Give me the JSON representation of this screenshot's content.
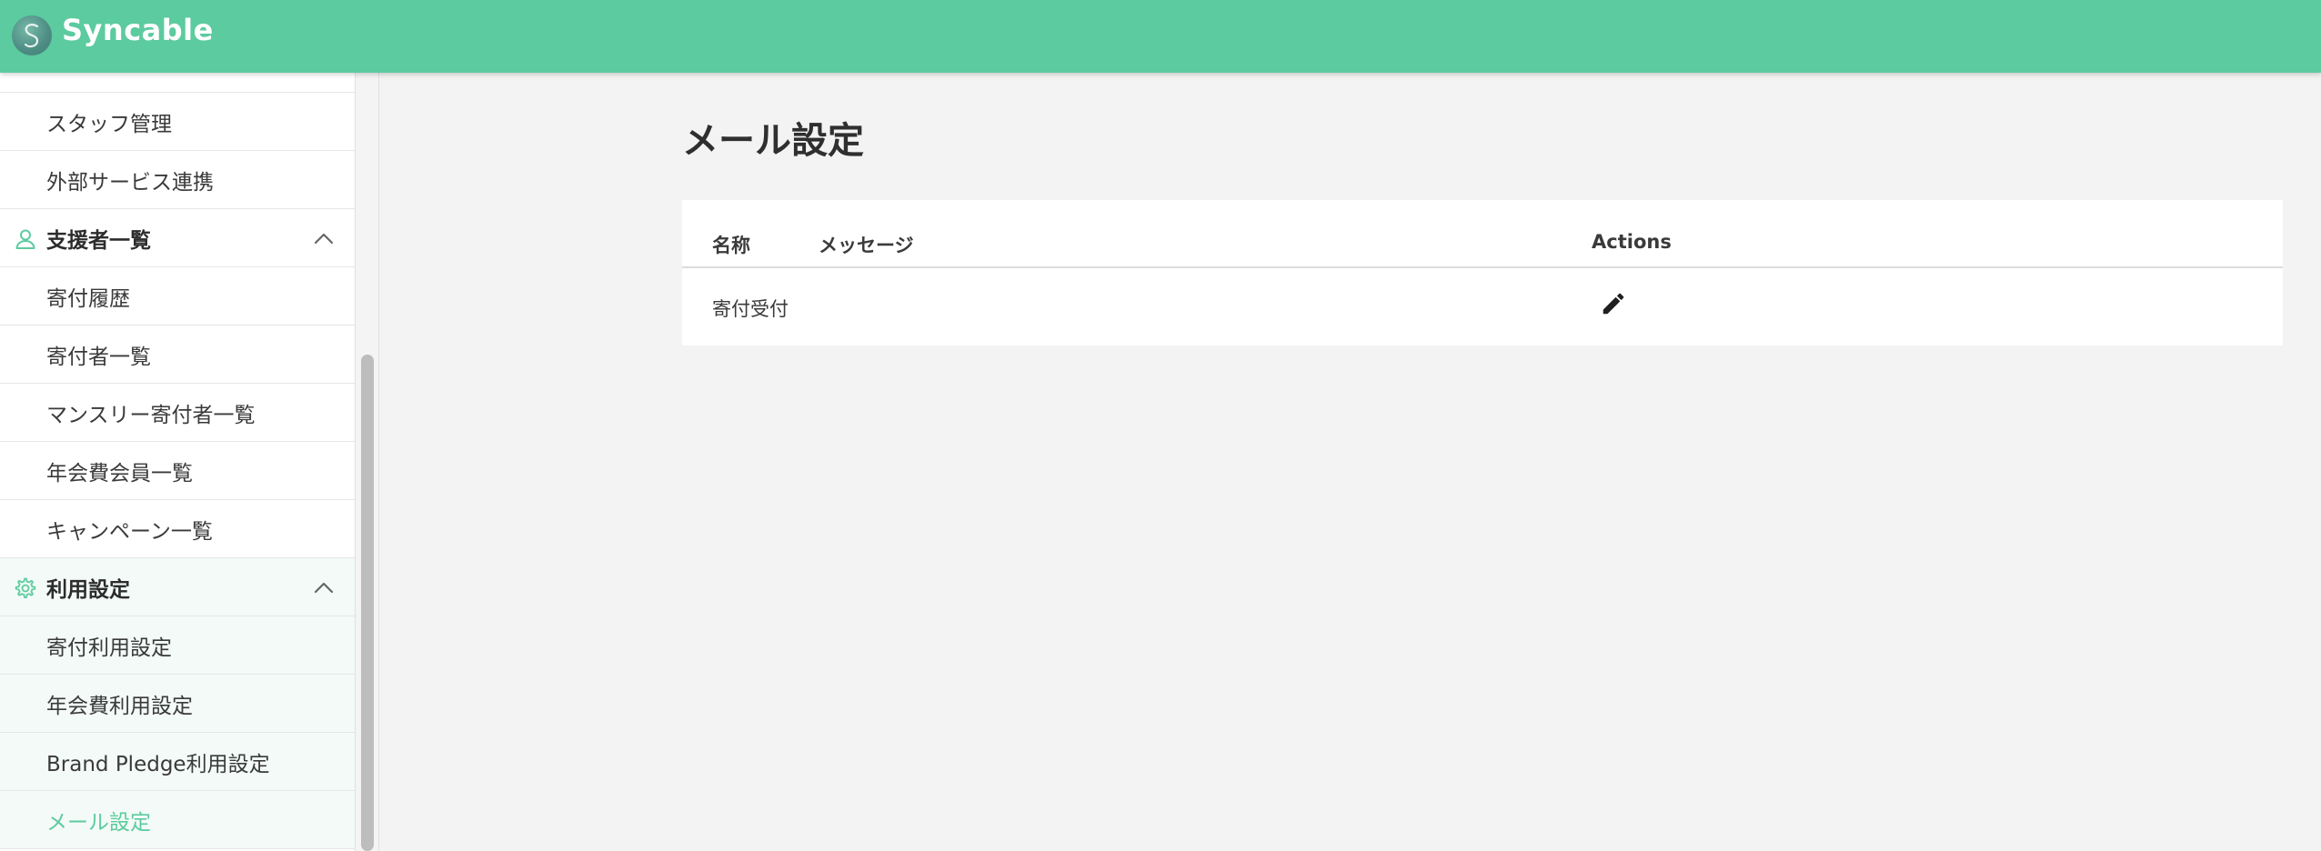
{
  "header": {
    "brand": "Syncable",
    "brand_color": "#5ccb9f"
  },
  "sidebar": {
    "items": [
      {
        "label": "スタッフ管理",
        "type": "item"
      },
      {
        "label": "外部サービス連携",
        "type": "item"
      },
      {
        "label": "支援者一覧",
        "type": "group",
        "icon": "person-icon",
        "expanded": true
      },
      {
        "label": "寄付履歴",
        "type": "item"
      },
      {
        "label": "寄付者一覧",
        "type": "item"
      },
      {
        "label": "マンスリー寄付者一覧",
        "type": "item"
      },
      {
        "label": "年会費会員一覧",
        "type": "item"
      },
      {
        "label": "キャンペーン一覧",
        "type": "item"
      },
      {
        "label": "利用設定",
        "type": "group",
        "icon": "gear-icon",
        "expanded": true
      },
      {
        "label": "寄付利用設定",
        "type": "item"
      },
      {
        "label": "年会費利用設定",
        "type": "item"
      },
      {
        "label": "Brand Pledge利用設定",
        "type": "item"
      },
      {
        "label": "メール設定",
        "type": "item",
        "active": true
      }
    ]
  },
  "main": {
    "title": "メール設定",
    "table": {
      "columns": [
        "名称",
        "メッセージ",
        "Actions"
      ],
      "rows": [
        {
          "name": "寄付受付",
          "message": "",
          "action_icon": "pencil-icon"
        }
      ]
    }
  }
}
